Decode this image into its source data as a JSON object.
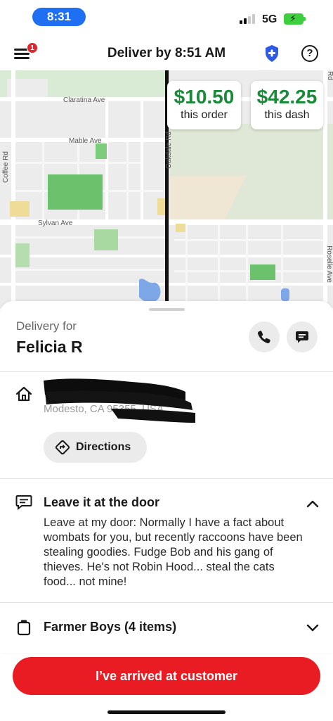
{
  "status_bar": {
    "time": "8:31",
    "network": "5G",
    "icons": [
      "signal-icon",
      "battery-charging-icon"
    ]
  },
  "header": {
    "title": "Deliver by 8:51 AM",
    "menu_badge": "1",
    "help_label": "?",
    "icons": [
      "menu-icon",
      "shield-plus-icon",
      "help-icon"
    ]
  },
  "map": {
    "street_labels": [
      "Claratina Ave",
      "Mable Ave",
      "Coffee Rd",
      "Oakdale Rd",
      "Sylvan Ave",
      "Roselle Ave",
      "Rd"
    ],
    "earnings": [
      {
        "amount": "$10.50",
        "label": "this order"
      },
      {
        "amount": "$42.25",
        "label": "this dash"
      }
    ],
    "colors": {
      "route": "#111111",
      "park": "#6cc26c",
      "water": "#7ea7e8",
      "block": "#dadada"
    }
  },
  "customer": {
    "label": "Delivery for",
    "name": "Felicia R",
    "call_icon": "phone-icon",
    "message_icon": "chat-icon"
  },
  "address": {
    "line1": "",
    "line2": "Modesto, CA 95355, USA",
    "redacted": true,
    "icon": "home-icon",
    "directions_label": "Directions",
    "directions_icon": "directions-icon"
  },
  "dropoff": {
    "title": "Leave it at the door",
    "body": "Leave at my door: Normally I have a fact about wombats for you, but recently raccoons have been stealing goodies.  Fudge Bob and his gang of thieves.  He's not Robin Hood... steal the cats food... not mine!",
    "icon": "note-icon",
    "expanded": true
  },
  "order": {
    "title": "Farmer Boys (4 items)",
    "icon": "bag-icon",
    "expanded": false
  },
  "actions": {
    "primary_label": "I’ve arrived at customer",
    "primary_color": "#ea1c23"
  }
}
